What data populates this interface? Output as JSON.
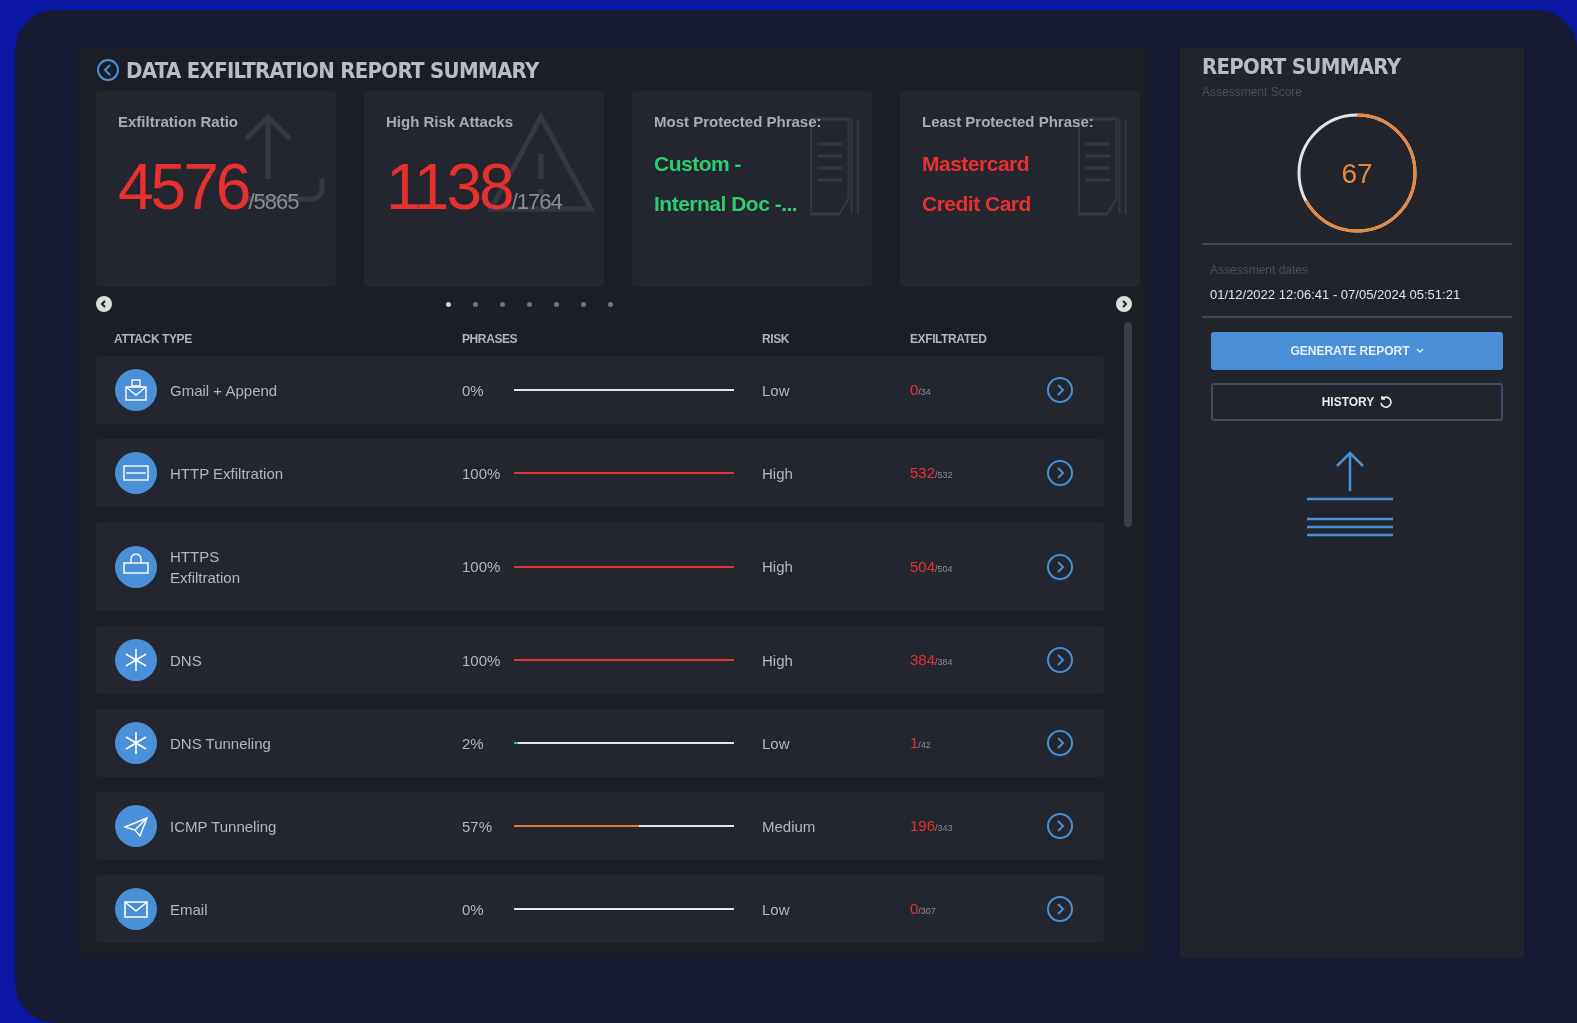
{
  "header": {
    "title": "DATA EXFILTRATION REPORT SUMMARY"
  },
  "cards": [
    {
      "kind": "ratio",
      "label": "Exfiltration Ratio",
      "value": "4576",
      "total": "/5865"
    },
    {
      "kind": "ratio",
      "label": "High Risk Attacks",
      "value": "1138",
      "total": "/1764"
    },
    {
      "kind": "phrase",
      "label": "Most Protected Phrase:",
      "lines": [
        "Custom -",
        "Internal Doc -..."
      ],
      "color": "#2ecc71"
    },
    {
      "kind": "phrase",
      "label": "Least Protected Phrase:",
      "lines": [
        "Mastercard",
        "Credit Card"
      ],
      "color": "#e8312f"
    }
  ],
  "carousel": {
    "dots": [
      {
        "selected": true
      },
      {
        "selected": false
      },
      {
        "selected": false
      },
      {
        "selected": false
      },
      {
        "selected": false
      },
      {
        "selected": false
      },
      {
        "selected": false
      }
    ]
  },
  "table": {
    "columns": [
      "ATTACK TYPE",
      "PHRASES",
      "RISK",
      "EXFILTRATED"
    ],
    "rows": [
      {
        "name": "Gmail + Append",
        "phrases": "0%",
        "level": 0,
        "color": "#e6e6e6",
        "risk": "Low",
        "exfiltrated": "0",
        "total": "/34"
      },
      {
        "name": "HTTP Exfiltration",
        "phrases": "100%",
        "level": 1,
        "color": "#e0342f",
        "risk": "High",
        "exfiltrated": "532",
        "total": "/532"
      },
      {
        "name": "HTTPS\nExfiltration",
        "phrases": "100%",
        "level": 1,
        "color": "#e0342f",
        "risk": "High",
        "exfiltrated": "504",
        "total": "/504"
      },
      {
        "name": "DNS",
        "phrases": "100%",
        "level": 1,
        "color": "#e0342f",
        "risk": "High",
        "exfiltrated": "384",
        "total": "/384"
      },
      {
        "name": "DNS Tunneling",
        "phrases": "2%",
        "level": 0.02,
        "color": "#2ecc71",
        "risk": "Low",
        "exfiltrated": "1",
        "total": "/42"
      },
      {
        "name": "ICMP Tunneling",
        "phrases": "57%",
        "level": 0.57,
        "color": "#e07b39",
        "risk": "Medium",
        "exfiltrated": "196",
        "total": "/343"
      },
      {
        "name": "Email",
        "phrases": "0%",
        "level": 0,
        "color": "#e6e6e6",
        "risk": "Low",
        "exfiltrated": "0",
        "total": "/307"
      }
    ]
  },
  "summary": {
    "title": "REPORT SUMMARY",
    "score_label": "Assessment Score",
    "score": "67",
    "dates_label": "Assessment dates",
    "dates": "01/12/2022 12:06:41 - 07/05/2024 05:51:21",
    "buttons": [
      {
        "kind": "primary",
        "label": "GENERATE REPORT"
      },
      {
        "kind": "outline",
        "label": "HISTORY"
      }
    ]
  }
}
